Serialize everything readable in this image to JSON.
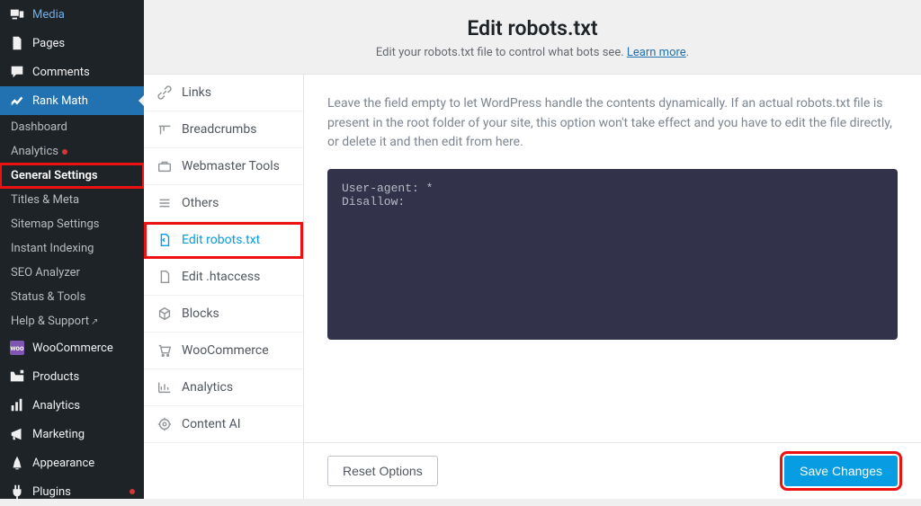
{
  "wp_sidebar": {
    "media": "Media",
    "pages": "Pages",
    "comments": "Comments",
    "rank_math": "Rank Math",
    "submenu": {
      "dashboard": "Dashboard",
      "analytics": "Analytics",
      "general_settings": "General Settings",
      "titles_meta": "Titles & Meta",
      "sitemap_settings": "Sitemap Settings",
      "instant_indexing": "Instant Indexing",
      "seo_analyzer": "SEO Analyzer",
      "status_tools": "Status & Tools",
      "help_support": "Help & Support"
    },
    "woocommerce": "WooCommerce",
    "products": "Products",
    "analytics2": "Analytics",
    "marketing": "Marketing",
    "appearance": "Appearance",
    "plugins": "Plugins"
  },
  "header": {
    "title": "Edit robots.txt",
    "subtitle_prefix": "Edit your robots.txt file to control what bots see. ",
    "learn_more": "Learn more"
  },
  "subnav": {
    "links": "Links",
    "breadcrumbs": "Breadcrumbs",
    "webmaster_tools": "Webmaster Tools",
    "others": "Others",
    "edit_robots": "Edit robots.txt",
    "edit_htaccess": "Edit .htaccess",
    "blocks": "Blocks",
    "woocommerce": "WooCommerce",
    "analytics": "Analytics",
    "content_ai": "Content AI"
  },
  "panel": {
    "help": "Leave the field empty to let WordPress handle the contents dynamically. If an actual robots.txt file is present in the root folder of your site, this option won't take effect and you have to edit the file directly, or delete it and then edit from here.",
    "code": "User-agent: *\nDisallow:"
  },
  "footer": {
    "reset": "Reset Options",
    "save": "Save Changes"
  }
}
